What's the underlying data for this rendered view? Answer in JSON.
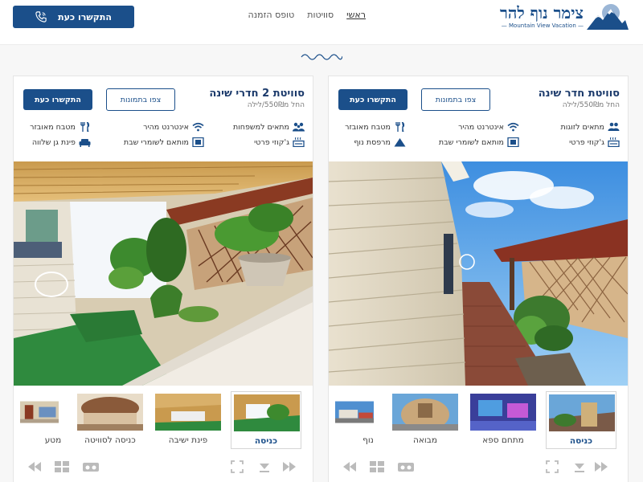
{
  "brand": {
    "name": "צימר נוף להר",
    "tagline": "— Mountain View Vacation —"
  },
  "nav": {
    "items": [
      "ראשי",
      "סוויטות",
      "טופס הזמנה"
    ],
    "active_index": 0
  },
  "header_call": {
    "label": "התקשרו כעת"
  },
  "colors": {
    "brand_blue": "#1b4f8a",
    "text_dark": "#2b2b2b"
  },
  "suites": [
    {
      "title": "סוויטת חדר שינה",
      "price": "החל מ550₪/לילה",
      "call_label": "התקשרו כעת",
      "pics_label": "צפו בתמונות",
      "features": [
        {
          "label": "מתאים לזוגות",
          "icon": "couple-icon"
        },
        {
          "label": "אינטרנט מהיר",
          "icon": "wifi-icon"
        },
        {
          "label": "מטבח מאובזר",
          "icon": "utensils-icon"
        },
        {
          "label": "ג'קוזי פרטי",
          "icon": "jacuzzi-icon"
        },
        {
          "label": "מותאם לשומרי שבת",
          "icon": "shabbat-icon"
        },
        {
          "label": "מרפסת נוף",
          "icon": "mountain-icon"
        }
      ],
      "thumbnails": [
        "כניסה",
        "מתחם ספא",
        "מבואה",
        "נוף"
      ],
      "selected_thumb": 0
    },
    {
      "title": "סוויטת 2 חדרי שינה",
      "price": "החל מ550₪/לילה",
      "call_label": "התקשרו כעת",
      "pics_label": "צפו בתמונות",
      "features": [
        {
          "label": "מתאים למשפחות",
          "icon": "family-icon"
        },
        {
          "label": "אינטרנט מהיר",
          "icon": "wifi-icon"
        },
        {
          "label": "מטבח מאובזר",
          "icon": "utensils-icon"
        },
        {
          "label": "ג'קוזי פרטי",
          "icon": "jacuzzi-icon"
        },
        {
          "label": "מותאם לשומרי שבת",
          "icon": "shabbat-icon"
        },
        {
          "label": "פינת גן שלווה",
          "icon": "sofa-icon"
        }
      ],
      "thumbnails": [
        "כניסה",
        "פינת ישיבה",
        "כניסה לסוויטה",
        "מטע"
      ],
      "selected_thumb": 0
    }
  ]
}
